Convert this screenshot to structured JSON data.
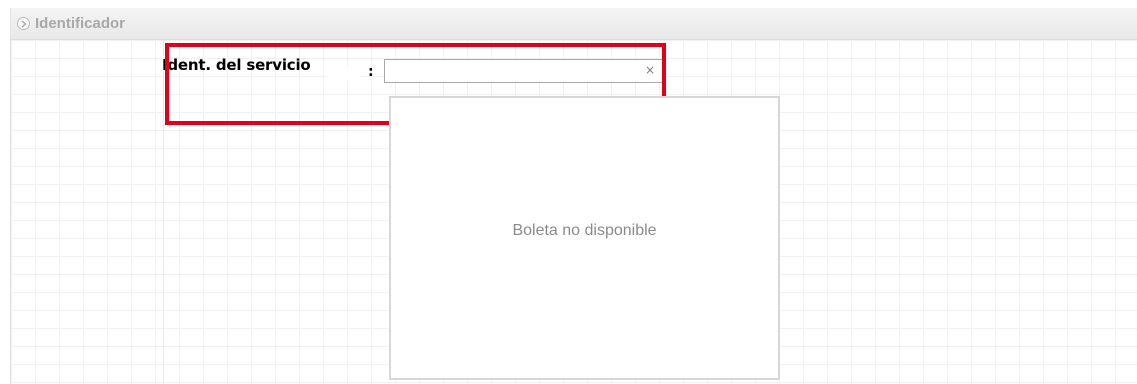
{
  "section": {
    "title": "Identificador",
    "icon": "chevron-right-circle-icon"
  },
  "form": {
    "service_id": {
      "label": "Ident. del servicio",
      "colon": ":",
      "value": "",
      "clear_icon": "close-icon",
      "clear_glyph": "×"
    }
  },
  "receipt": {
    "message": "Boleta no disponible"
  },
  "colors": {
    "highlight": "#e0001b",
    "header_text": "#a8a8a8",
    "placeholder_text": "#8a8a8a"
  }
}
